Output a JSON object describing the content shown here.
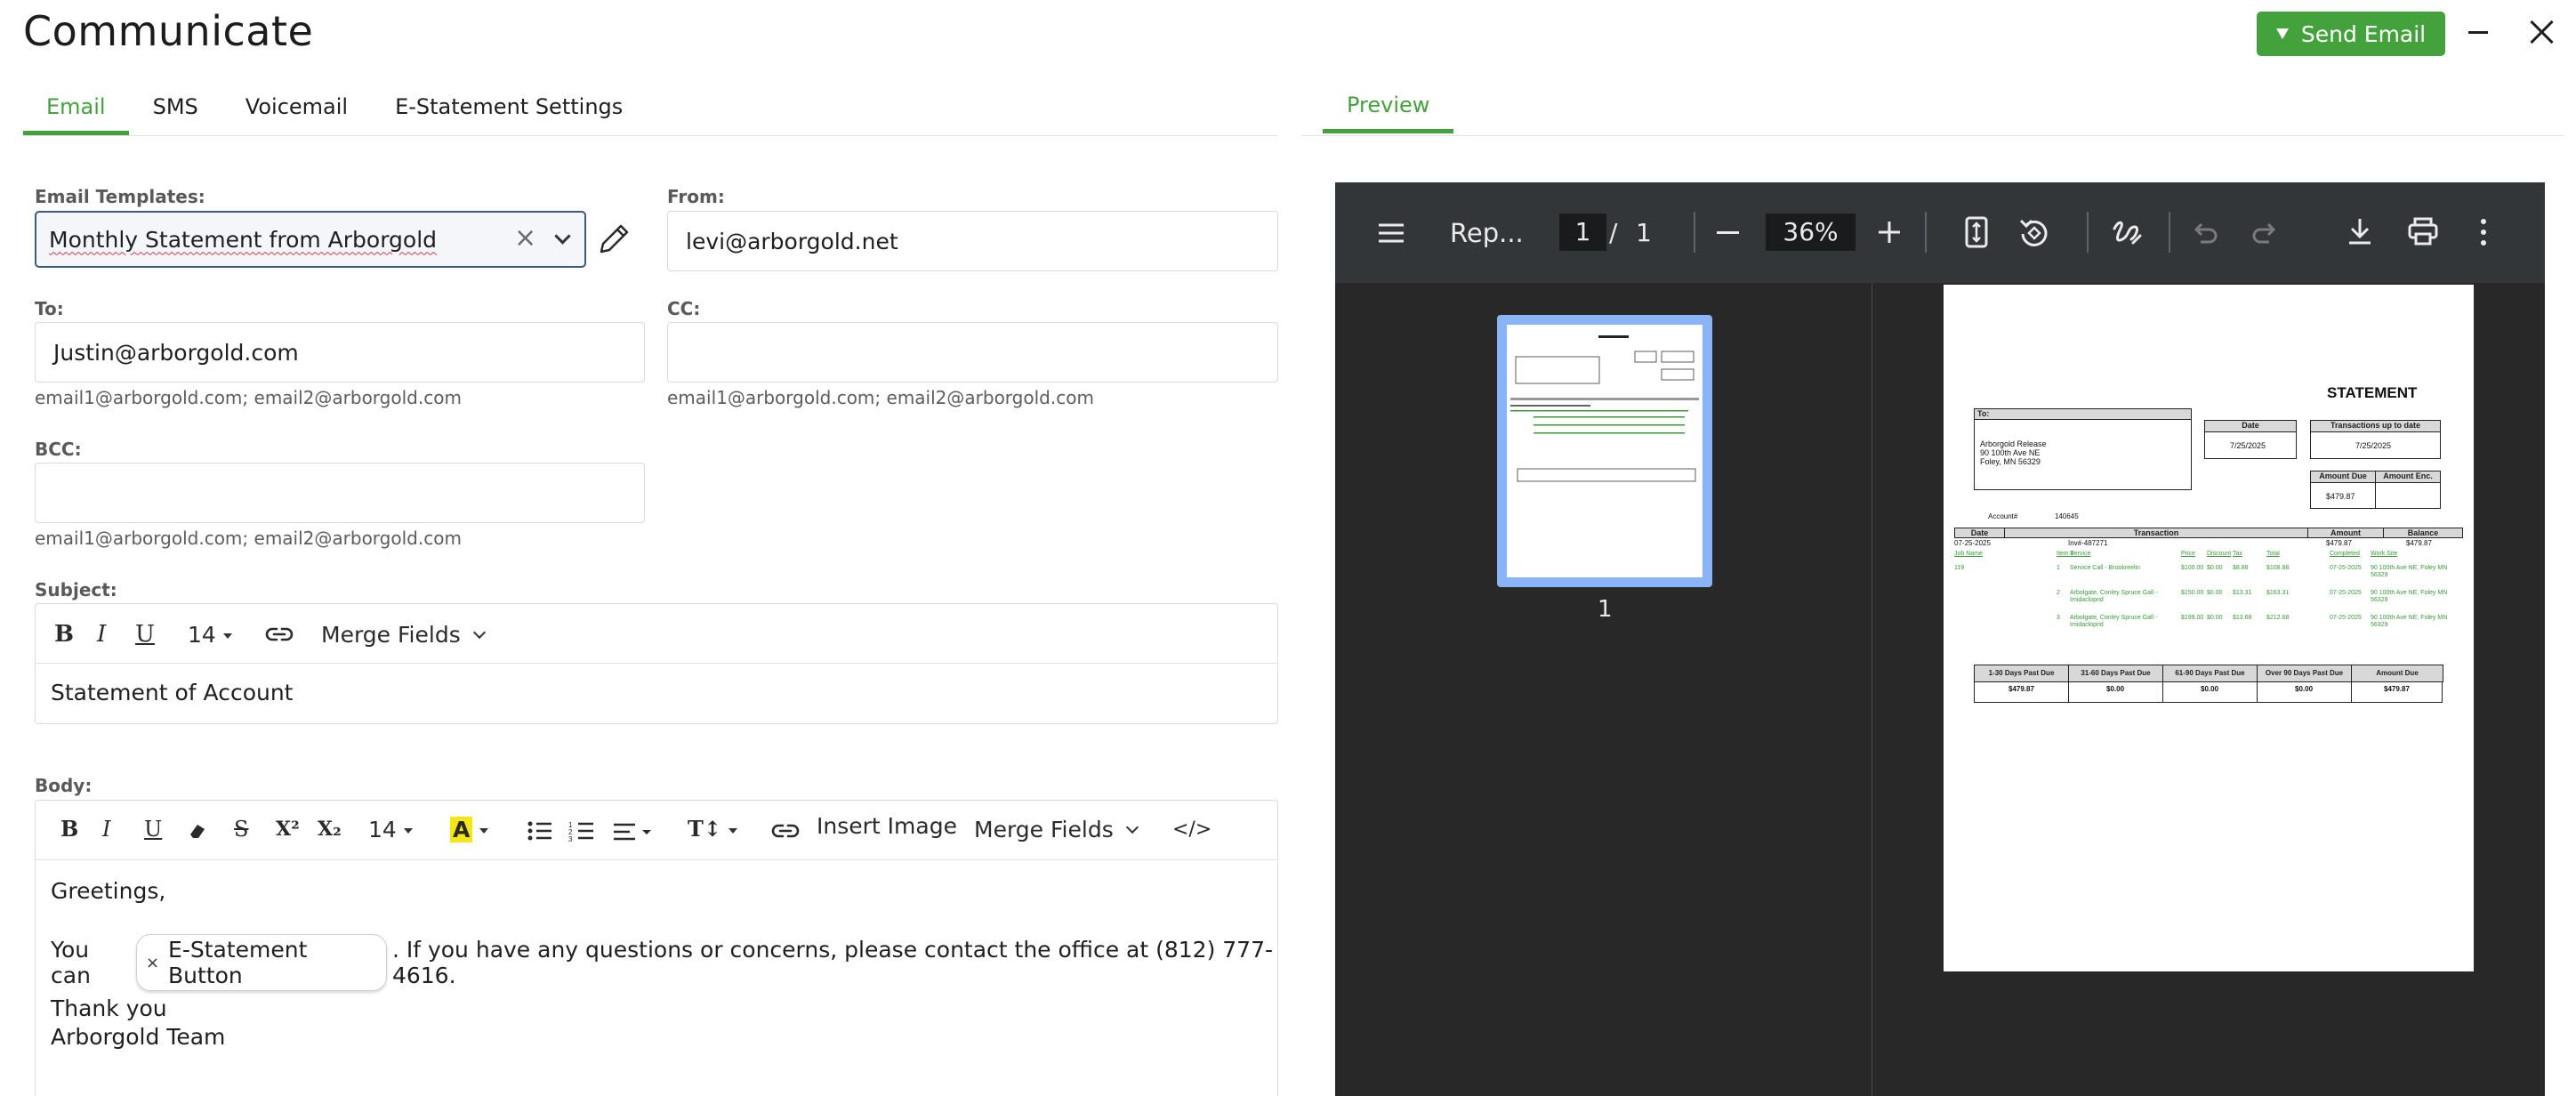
{
  "header": {
    "title": "Communicate",
    "send_label": "Send Email"
  },
  "tabs": [
    "Email",
    "SMS",
    "Voicemail",
    "E-Statement Settings"
  ],
  "preview_tab": "Preview",
  "form": {
    "templates_label": "Email Templates:",
    "template_value": "Monthly Statement from Arborgold",
    "from_label": "From:",
    "from_value": "levi@arborgold.net",
    "to_label": "To:",
    "to_value": "Justin@arborgold.com",
    "cc_label": "CC:",
    "cc_value": "",
    "bcc_label": "BCC:",
    "bcc_value": "",
    "address_hint": "email1@arborgold.com; email2@arborgold.com",
    "subject_label": "Subject:",
    "subject_value": "Statement of Account",
    "body_label": "Body:"
  },
  "subject_toolbar": {
    "bold": "B",
    "italic": "I",
    "underline": "U",
    "font_size": "14",
    "merge_fields": "Merge Fields"
  },
  "body_toolbar": {
    "bold": "B",
    "italic": "I",
    "underline": "U",
    "strike": "S",
    "superscript": "X²",
    "subscript": "X₂",
    "font_size": "14",
    "highlight": "A",
    "text_transform": "T↕",
    "insert_image": "Insert Image",
    "merge_fields": "Merge Fields",
    "code": "</>"
  },
  "body": {
    "greeting": "Greetings,",
    "line_before": "You can",
    "chip_x": "×",
    "chip_label": "E-Statement Button",
    "line_after": ". If you have any questions or concerns, please contact the office at (812) 777-4616.",
    "thanks": "Thank you",
    "signature": "Arborgold Team"
  },
  "pdf_viewer": {
    "doc_title": "Rep...",
    "page_current": "1",
    "page_sep": "/",
    "page_total": "1",
    "zoom": "36%",
    "thumb_label": "1"
  },
  "statement": {
    "title": "STATEMENT",
    "to_label": "To:",
    "address": [
      "Arborgold Release",
      "90 100th Ave NE",
      "Foley, MN  56329"
    ],
    "date_label": "Date",
    "date_value": "7/25/2025",
    "tx_label": "Transactions up to date",
    "tx_value": "7/25/2025",
    "amount_due_label": "Amount Due",
    "amount_enc_label": "Amount Enc.",
    "amount_due_value": "$479.87",
    "account_label": "Account#",
    "account_value": "140645",
    "table_headers": [
      "Date",
      "Transaction",
      "Amount",
      "Balance"
    ],
    "row_date": "07-25-2025",
    "row_tx": "Inv#-487271",
    "row_amount": "$479.87",
    "row_balance": "$479.87",
    "detail_headers": [
      "Job Name",
      "Item #",
      "Service",
      "Price",
      "Discount",
      "Tax",
      "Total",
      "Completed",
      "Work Site"
    ],
    "detail_rows": [
      [
        "119",
        "1",
        "Service Call - Brookreelin",
        "$100.00",
        "$0.00",
        "$8.88",
        "$108.88",
        "07-25-2025",
        "90 100th Ave NE, Foley MN 56329"
      ],
      [
        "",
        "2",
        "Arbolgate, Conley Spruce Gall - Imidacloprid",
        "$150.00",
        "$0.00",
        "$13.31",
        "$163.31",
        "07-25-2025",
        "90 100th Ave NE, Foley MN 56329"
      ],
      [
        "",
        "3",
        "Arbolgate, Conley Spruce Gall - Imidacloprid",
        "$199.00",
        "$0.00",
        "$13.68",
        "$212.68",
        "07-25-2025",
        "90 100th Ave NE, Foley MN 56329"
      ]
    ],
    "aging_headers": [
      "1-30 Days Past Due",
      "31-60 Days Past Due",
      "61-90 Days Past Due",
      "Over 90 Days Past Due",
      "Amount Due"
    ],
    "aging_values": [
      "$479.87",
      "$0.00",
      "$0.00",
      "$0.00",
      "$479.87"
    ]
  },
  "colors": {
    "accent": "#43a23b",
    "select_border": "#3d5a80",
    "pdf_toolbar": "#333639",
    "pdf_bg": "#282828",
    "thumb_highlight": "#8ab4f8"
  }
}
